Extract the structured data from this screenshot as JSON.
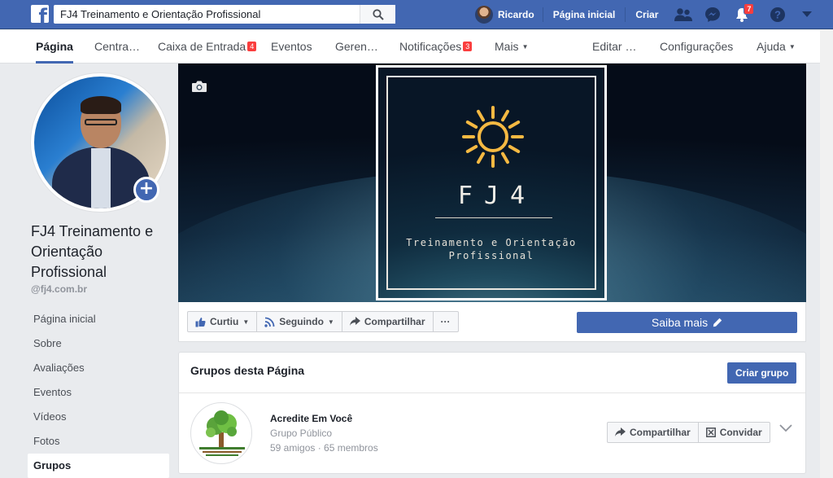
{
  "topbar": {
    "logo": "f",
    "search_value": "FJ4 Treinamento e Orientação Profissional",
    "user_name": "Ricardo",
    "home_label": "Página inicial",
    "create_label": "Criar",
    "notifications_count": "7"
  },
  "pagenav": {
    "pagina": "Página",
    "centro": "Centra…",
    "caixa": "Caixa de Entrada",
    "caixa_badge": "4",
    "eventos": "Eventos",
    "gerenciador": "Geren…",
    "notificacoes": "Notificações",
    "notificacoes_badge": "3",
    "mais": "Mais",
    "editar": "Editar …",
    "configuracoes": "Configurações",
    "ajuda": "Ajuda"
  },
  "profile": {
    "name": "FJ4 Treinamento e Orientação Profissional",
    "handle": "@fj4.com.br"
  },
  "sidebar": {
    "items": [
      {
        "label": "Página inicial"
      },
      {
        "label": "Sobre"
      },
      {
        "label": "Avaliações"
      },
      {
        "label": "Eventos"
      },
      {
        "label": "Vídeos"
      },
      {
        "label": "Fotos"
      },
      {
        "label": "Grupos"
      }
    ]
  },
  "cover": {
    "title": "FJ4",
    "subtitle_line1": "Treinamento e Orientação",
    "subtitle_line2": "Profissional",
    "sun_color": "#f5b942"
  },
  "actions": {
    "curtiu": "Curtiu",
    "seguindo": "Seguindo",
    "compartilhar": "Compartilhar",
    "more": "···",
    "saiba_mais": "Saiba mais"
  },
  "groups": {
    "title": "Grupos desta Página",
    "create_label": "Criar grupo",
    "items": [
      {
        "name": "Acredite Em Você",
        "type": "Grupo Público",
        "stats": "59 amigos · 65 membros",
        "share_label": "Compartilhar",
        "invite_label": "Convidar"
      }
    ]
  },
  "colors": {
    "brand": "#4267b2",
    "badge": "#fa3e3e"
  }
}
